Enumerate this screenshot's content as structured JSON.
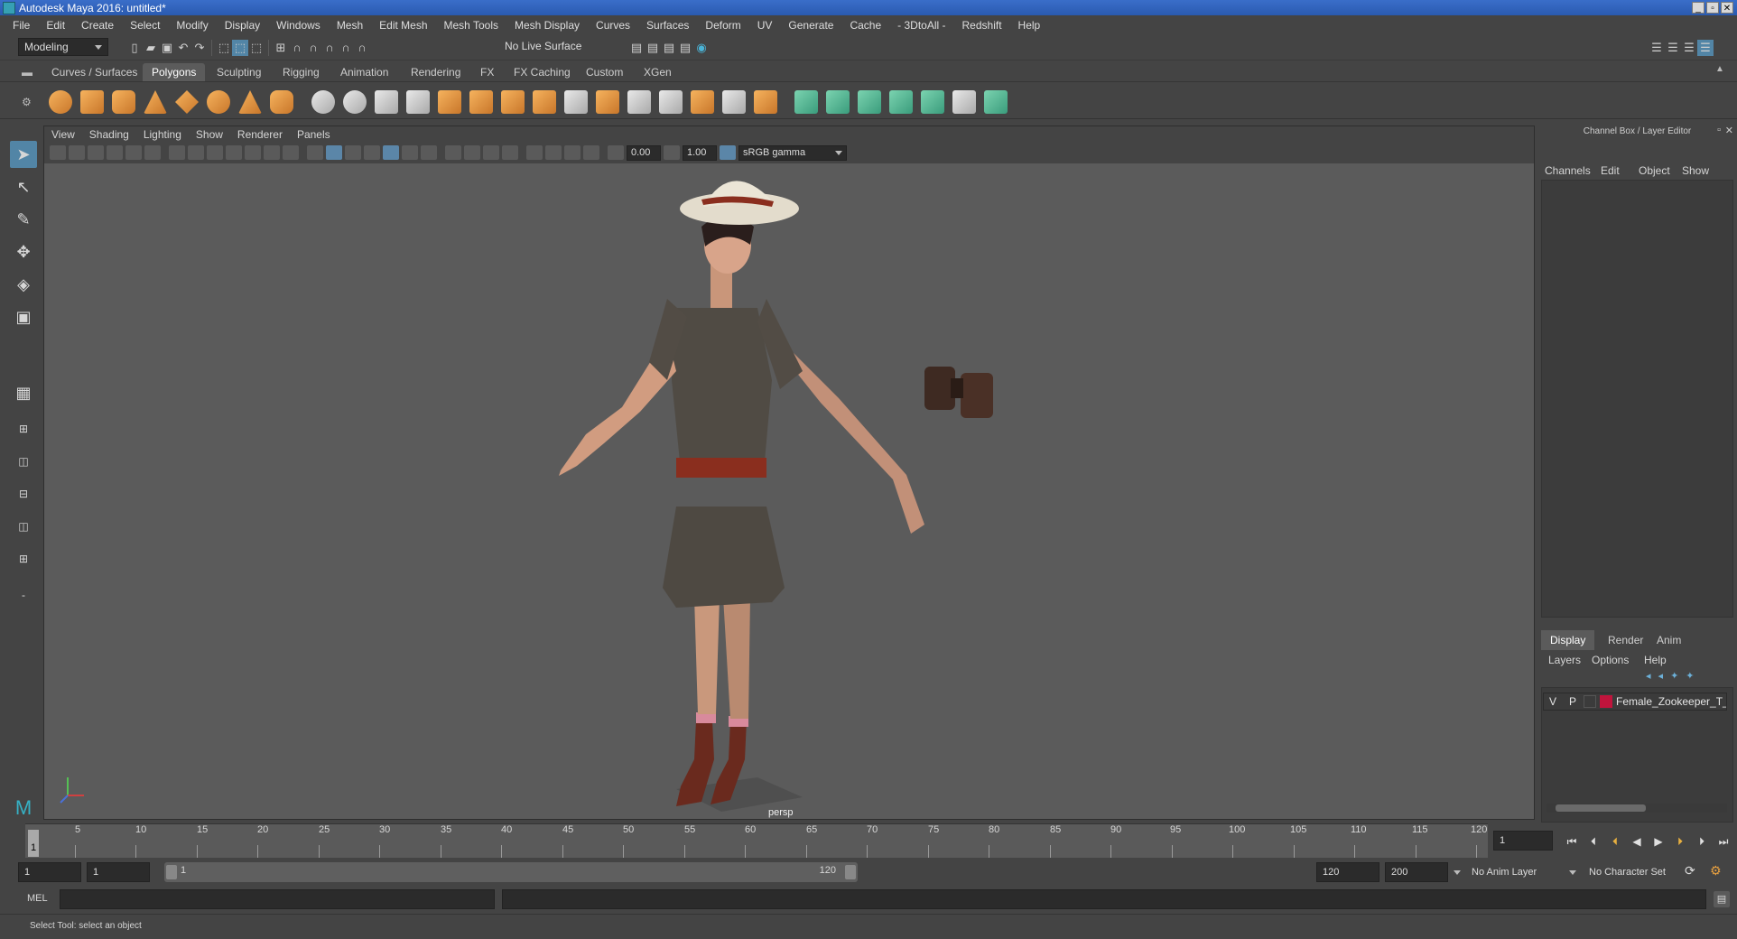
{
  "window": {
    "title": "Autodesk Maya 2016: untitled*",
    "controls": [
      "_",
      "▫",
      "✕"
    ]
  },
  "menubar": {
    "items": [
      "File",
      "Edit",
      "Create",
      "Select",
      "Modify",
      "Display",
      "Windows",
      "Mesh",
      "Edit Mesh",
      "Mesh Tools",
      "Mesh Display",
      "Curves",
      "Surfaces",
      "Deform",
      "UV",
      "Generate",
      "Cache",
      "- 3DtoAll -",
      "Redshift",
      "Help"
    ]
  },
  "statusline": {
    "menuset": "Modeling",
    "live_surface": "No Live Surface"
  },
  "shelf": {
    "tabs": [
      "Curves / Surfaces",
      "Polygons",
      "Sculpting",
      "Rigging",
      "Animation",
      "Rendering",
      "FX",
      "FX Caching",
      "Custom",
      "XGen"
    ],
    "active_tab": "Polygons"
  },
  "viewport": {
    "panel_menus": [
      "View",
      "Shading",
      "Lighting",
      "Show",
      "Renderer",
      "Panels"
    ],
    "exposure": "0.00",
    "gamma": "1.00",
    "color_space": "sRGB gamma",
    "camera": "persp"
  },
  "channelbox": {
    "title": "Channel Box / Layer Editor",
    "menus": [
      "Channels",
      "Edit",
      "Object",
      "Show"
    ],
    "tabs": [
      "Display",
      "Render",
      "Anim"
    ],
    "active_tab": "Display",
    "layer_menus": [
      "Layers",
      "Options",
      "Help"
    ],
    "layer": {
      "visible": "V",
      "playback": "P",
      "name": "Female_Zookeeper_T_P",
      "color": "#c0143c"
    }
  },
  "timeslider": {
    "ticks": [
      "5",
      "10",
      "15",
      "20",
      "25",
      "30",
      "35",
      "40",
      "45",
      "50",
      "55",
      "60",
      "65",
      "70",
      "75",
      "80",
      "85",
      "90",
      "95",
      "100",
      "105",
      "110",
      "115",
      "120"
    ],
    "current_frame_marker": "1",
    "current_frame_field": "1"
  },
  "range": {
    "start": "1",
    "playback_start": "1",
    "range_start_label": "1",
    "range_end_label": "120",
    "playback_end": "120",
    "end": "200",
    "anim_layer": "No Anim Layer",
    "character_set": "No Character Set"
  },
  "commandline": {
    "language": "MEL"
  },
  "helpline": {
    "text": "Select Tool: select an object"
  }
}
